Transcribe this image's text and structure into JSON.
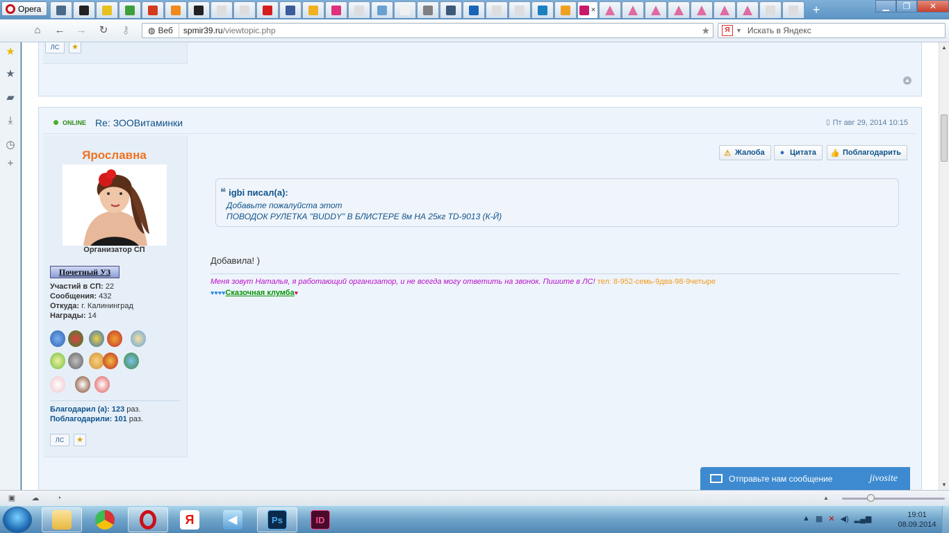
{
  "browser": {
    "menu_label": "Opera",
    "tabs": [
      {
        "icon": "speed-dial-icon",
        "color": "#4a6a8a"
      },
      {
        "icon": "site-a-icon",
        "color": "#222222"
      },
      {
        "icon": "sun-icon",
        "color": "#e8c020"
      },
      {
        "icon": "windows-logo-icon",
        "color": "#3c9f3c"
      },
      {
        "icon": "soviet-icon",
        "color": "#d33b1e"
      },
      {
        "icon": "orange-square-icon",
        "color": "#f08a1c"
      },
      {
        "icon": "v-icon",
        "color": "#222222"
      },
      {
        "icon": "page-icon",
        "color": "#dddddd"
      },
      {
        "icon": "page-icon",
        "color": "#dddddd"
      },
      {
        "icon": "adobe-icon",
        "color": "#d71e1e"
      },
      {
        "icon": "person-icon",
        "color": "#3b5b9b"
      },
      {
        "icon": "ring-icon",
        "color": "#f0b020"
      },
      {
        "icon": "pink-badge-icon",
        "color": "#e0307b"
      },
      {
        "icon": "page-icon",
        "color": "#dddddd"
      },
      {
        "icon": "photo-icon",
        "color": "#6aa0d0"
      },
      {
        "icon": "blank-icon",
        "color": "#f0f0f0"
      },
      {
        "icon": "m-icon",
        "color": "#808080"
      },
      {
        "icon": "train-icon",
        "color": "#3a5a7a"
      },
      {
        "icon": "k-icon",
        "color": "#1a63b8"
      },
      {
        "icon": "page-icon",
        "color": "#dddddd"
      },
      {
        "icon": "page-icon",
        "color": "#dddddd"
      },
      {
        "icon": "target-icon",
        "color": "#1c7fc0"
      },
      {
        "icon": "chart-icon",
        "color": "#f0a020"
      },
      {
        "icon": "sp-icon",
        "color": "#c81a6a",
        "active": true
      },
      {
        "icon": "dress-icon",
        "color": "#e06aa2"
      },
      {
        "icon": "dress-icon",
        "color": "#e06aa2"
      },
      {
        "icon": "dress-icon",
        "color": "#e06aa2"
      },
      {
        "icon": "dress-icon",
        "color": "#e06aa2"
      },
      {
        "icon": "dress-icon",
        "color": "#e06aa2"
      },
      {
        "icon": "dress-icon",
        "color": "#e06aa2"
      },
      {
        "icon": "dress-icon",
        "color": "#e06aa2"
      },
      {
        "icon": "page-icon",
        "color": "#dddddd"
      },
      {
        "icon": "page-icon",
        "color": "#dddddd"
      }
    ],
    "address": {
      "mode_label": "Веб",
      "domain": "spmir39.ru",
      "path": "/viewtopic.php"
    },
    "search": {
      "engine_icon": "Я",
      "placeholder": "Искать в Яндекс"
    }
  },
  "page": {
    "prev_post": {
      "pm_label": "ЛС"
    },
    "post": {
      "status": "ONLINE",
      "title": "Re: ЗООВитаминки",
      "date": "Пт авг 29, 2014 10:15",
      "author": {
        "name": "Ярославна",
        "rank": "Организатор СП",
        "rank_badge": "Почетный УЗ",
        "stats": [
          {
            "label": "Участий в СП:",
            "value": "22"
          },
          {
            "label": "Сообщения:",
            "value": "432"
          },
          {
            "label": "Откуда:",
            "value": "г. Калининград"
          },
          {
            "label": "Награды:",
            "value": "14"
          }
        ],
        "thanks_given_label": "Благодарил (а):",
        "thanks_given_value": "123",
        "thanks_given_suffix": "раз.",
        "thanks_received_label": "Поблагодарили:",
        "thanks_received_value": "101",
        "thanks_received_suffix": "раз.",
        "pm_label": "ЛС"
      },
      "actions": {
        "complain": "Жалоба",
        "quote": "Цитата",
        "thank": "Поблагодарить"
      },
      "quote": {
        "author": "igbi писал(а):",
        "line1": "Добавьте пожалуйста этот",
        "line2": "ПОВОДОК РУЛЕТКА \"BUDDY\" В БЛИСТЕРЕ 8м НА 25кг TD-9013 (К-Й)"
      },
      "message": "Добавила! )",
      "signature": {
        "text": "Меня зовут Наталья, я работающий организатор, и не всегда могу ответить на звонок. Пишите в ЛС!",
        "phone": "тел: 8-952-семь-9два-98-9четыре",
        "hearts_before": "♥♥♥♥",
        "link": "Сказочная клумба",
        "heart_after": "♥"
      }
    },
    "jivo": {
      "label": "Отправьте нам сообщение",
      "brand": "jivosite"
    }
  },
  "taskbar": {
    "apps": [
      {
        "name": "explorer",
        "icon": "folder-icon"
      },
      {
        "name": "chrome",
        "icon": "chrome-icon"
      },
      {
        "name": "opera",
        "icon": "opera-icon"
      },
      {
        "name": "yandex",
        "icon": "yandex-icon",
        "text": "Я"
      },
      {
        "name": "sound",
        "icon": "speaker-app-icon"
      },
      {
        "name": "photoshop",
        "icon": "photoshop-icon",
        "text": "Ps"
      },
      {
        "name": "indesign",
        "icon": "indesign-icon",
        "text": "ID"
      }
    ],
    "time": "19:01",
    "date": "08.09.2014"
  }
}
